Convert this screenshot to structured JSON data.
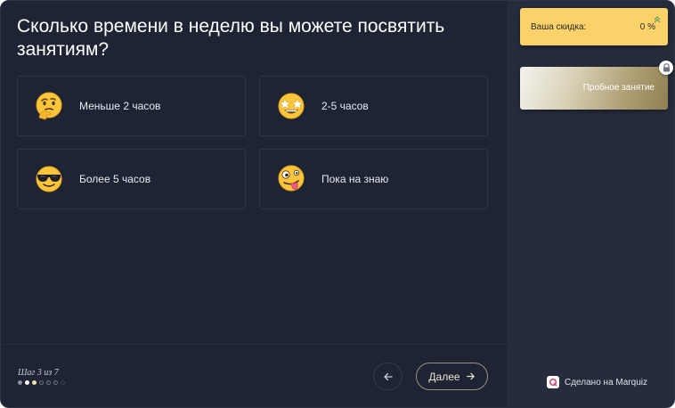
{
  "quiz": {
    "question": "Сколько времени в неделю вы можете посвятить занятиям?",
    "options": [
      {
        "label": "Меньше 2 часов",
        "icon": "thinking-face-icon"
      },
      {
        "label": "2-5 часов",
        "icon": "star-struck-face-icon"
      },
      {
        "label": "Более 5 часов",
        "icon": "sunglasses-face-icon"
      },
      {
        "label": "Пока на знаю",
        "icon": "zany-face-icon"
      }
    ]
  },
  "footer": {
    "step_text": "Шаг 3 из 7",
    "progress": {
      "current_step": 3,
      "total_steps": 7
    },
    "back_icon": "arrow-left-icon",
    "next_label": "Далее",
    "next_icon": "arrow-right-icon"
  },
  "sidebar": {
    "discount_label": "Ваша скидка:",
    "discount_value": "0 %",
    "trial_label": "Пробное занятие",
    "made_by": "Сделано на Marquiz"
  },
  "colors": {
    "background": "#1e2433",
    "sidebar": "#252c3c",
    "discount_card": "#fbd26a",
    "accent_gold": "#9a9278"
  }
}
